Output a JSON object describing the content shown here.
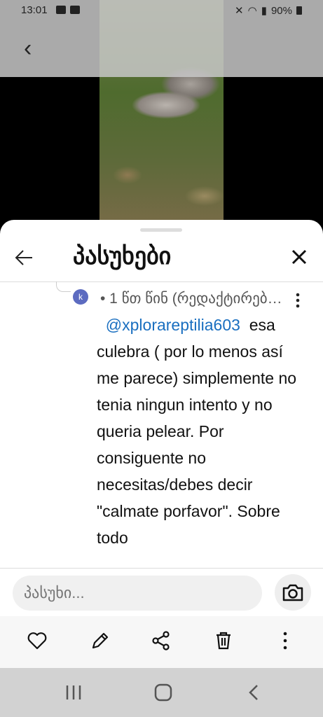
{
  "status_bar": {
    "time": "13:01",
    "battery": "90%"
  },
  "sheet": {
    "title": "პასუხები"
  },
  "comment": {
    "avatar_letter": "k",
    "meta": "• 1 წთ წინ (რედაქტირებული)",
    "mention": "@xplorareptilia603",
    "text": "esa culebra ( por lo menos así me parece) simplemente no tenia ningun intento y  no queria pelear. Por consiguente no necesitas/debes decir \"calmate porfavor\". Sobre todo"
  },
  "reply": {
    "placeholder": "პასუხი..."
  },
  "icons": [
    "back-arrow-icon",
    "close-icon",
    "more-vert-icon",
    "camera-icon",
    "heart-icon",
    "pencil-icon",
    "share-icon",
    "trash-icon",
    "recent-apps-icon",
    "home-icon",
    "back-icon"
  ]
}
